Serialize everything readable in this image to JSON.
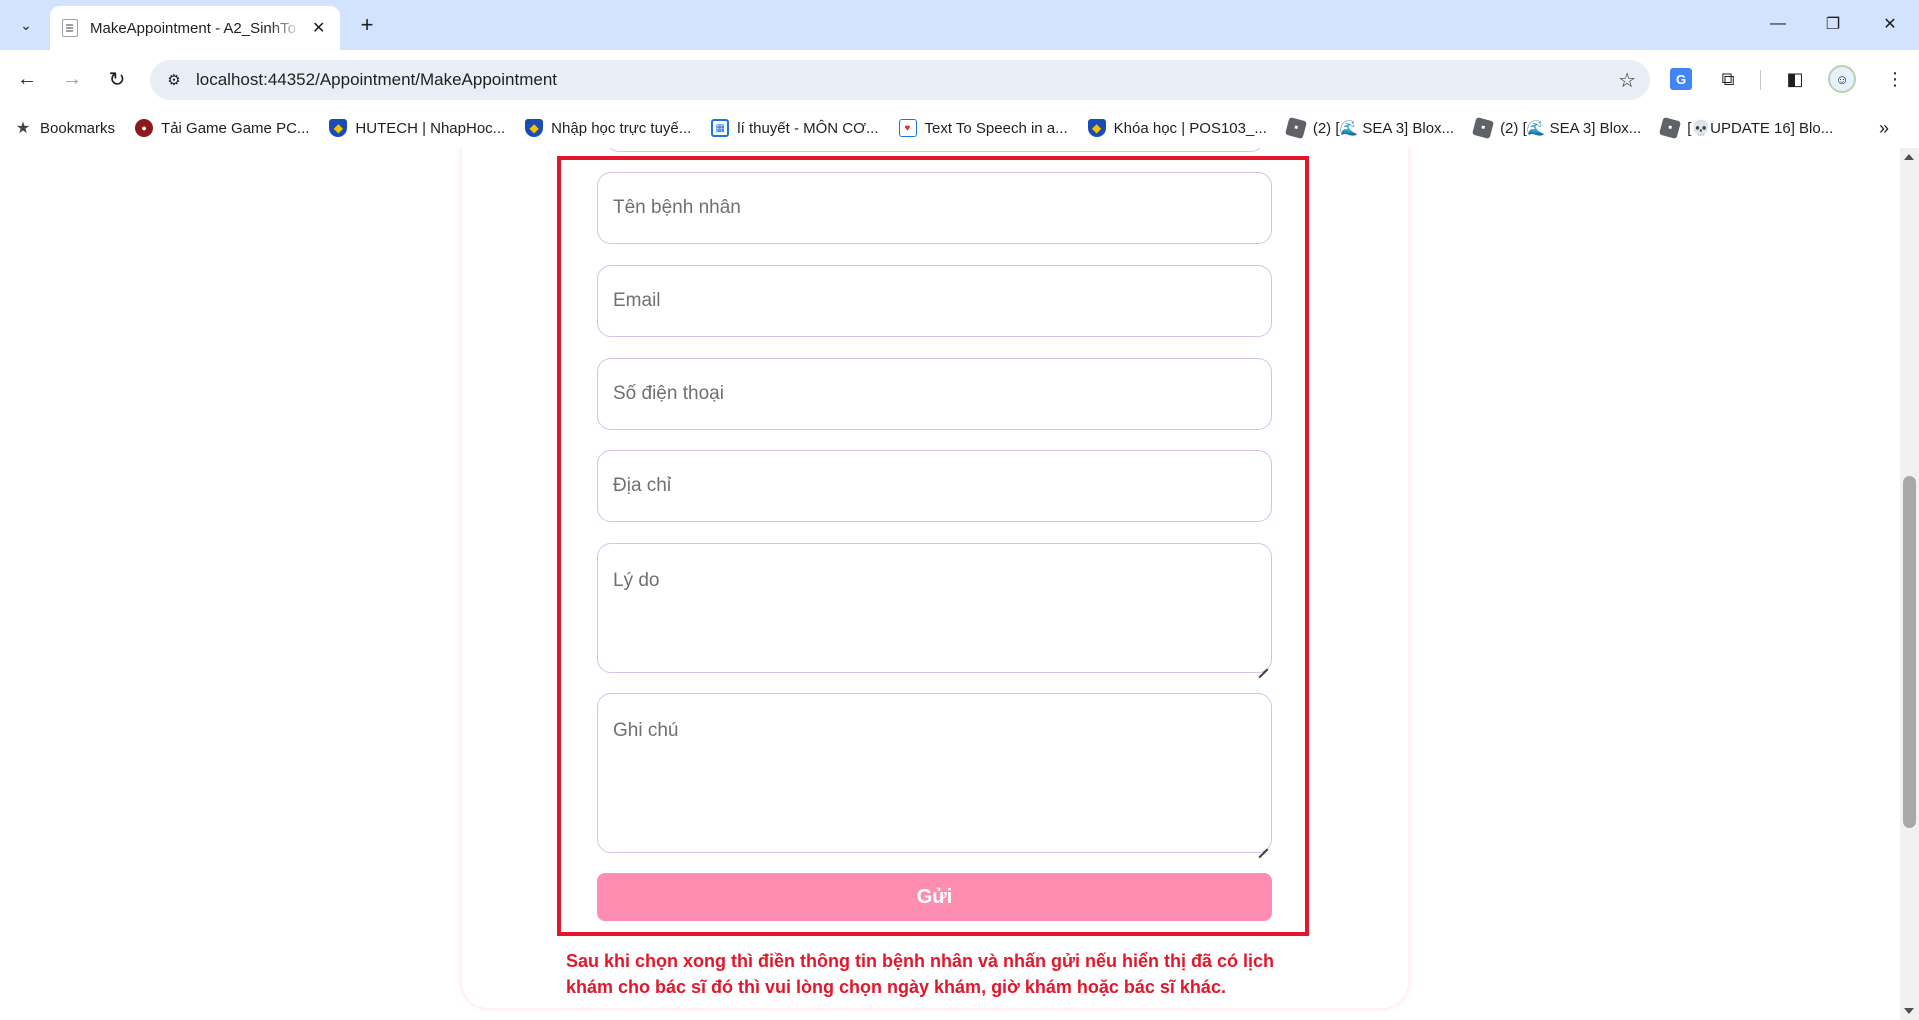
{
  "browser": {
    "tab_title": "MakeAppointment - A2_SinhTo",
    "url": "localhost:44352/Appointment/MakeAppointment",
    "bookmarks": [
      {
        "label": "Bookmarks",
        "icon": "star-icon"
      },
      {
        "label": "Tải Game Game PC...",
        "icon": "game-icon"
      },
      {
        "label": "HUTECH | NhapHoc...",
        "icon": "shield-icon"
      },
      {
        "label": "Nhập học trực tuyế...",
        "icon": "shield-icon"
      },
      {
        "label": "lí thuyết - MÔN CƠ...",
        "icon": "table-icon"
      },
      {
        "label": "Text To Speech in a...",
        "icon": "speech-icon"
      },
      {
        "label": "Khóa học | POS103_...",
        "icon": "shield-icon"
      },
      {
        "label": "(2) [🌊 SEA 3] Blox...",
        "icon": "roblox-icon"
      },
      {
        "label": "(2) [🌊 SEA 3] Blox...",
        "icon": "roblox-icon"
      },
      {
        "label": "[💀UPDATE 16] Blo...",
        "icon": "roblox-icon"
      }
    ]
  },
  "form": {
    "patient_name_placeholder": "Tên bệnh nhân",
    "email_placeholder": "Email",
    "phone_placeholder": "Số điện thoại",
    "address_placeholder": "Địa chỉ",
    "reason_placeholder": "Lý do",
    "note_placeholder": "Ghi chú",
    "submit_label": "Gửi"
  },
  "annotation": {
    "text": "Sau khi chọn xong thì điền thông tin bệnh nhân và nhấn gửi nếu hiển thị đã có lịch khám cho bác sĩ đó thì vui lòng chọn ngày khám, giờ khám hoặc bác sĩ khác."
  },
  "colors": {
    "highlight": "#e3172b",
    "submit": "#ff8db2",
    "field_border": "#d7c2ec"
  }
}
